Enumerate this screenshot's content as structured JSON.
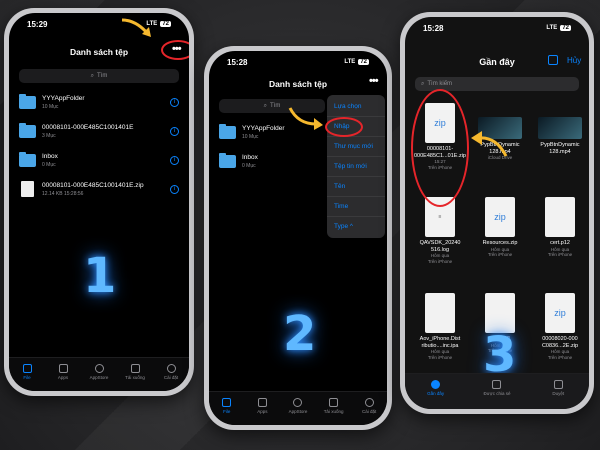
{
  "phone1": {
    "time": "15:29",
    "network": "LTE",
    "battery": "72",
    "title": "Danh sách tệp",
    "more": "•••",
    "search_placeholder": "Tìm",
    "rows": [
      {
        "name": "YYYAppFolder",
        "sub": "10 Mục",
        "type": "folder"
      },
      {
        "name": "00008101-000E485C1001401E",
        "sub": "3 Mục",
        "type": "folder"
      },
      {
        "name": "Inbox",
        "sub": "0 Mục",
        "type": "folder"
      },
      {
        "name": "00008101-000E485C1001401E.zip",
        "sub": "12.14 KB   15:28:56",
        "type": "file"
      }
    ],
    "tabs": [
      "File",
      "Apps",
      "AppStore",
      "Tải xuống",
      "Cài đặt"
    ],
    "step": "1"
  },
  "phone2": {
    "time": "15:28",
    "network": "LTE",
    "battery": "72",
    "title": "Danh sách tệp",
    "more": "•••",
    "search_placeholder": "Tìm",
    "rows": [
      {
        "name": "YYYAppFolder",
        "sub": "10 Mục",
        "type": "folder"
      },
      {
        "name": "Inbox",
        "sub": "0 Mục",
        "type": "folder"
      }
    ],
    "menu": [
      "Lựa chọn",
      "Nhập",
      "Thư mục mới",
      "Tệp tin mới",
      "Tên",
      "Time",
      "Type ^"
    ],
    "tabs": [
      "File",
      "Apps",
      "AppStore",
      "Tải xuống",
      "Cài đặt"
    ],
    "step": "2"
  },
  "phone3": {
    "time": "15:28",
    "network": "LTE",
    "battery": "72",
    "title": "Gần đây",
    "select": "Hủy",
    "search_placeholder": "Tìm kiếm",
    "items": [
      {
        "thumb": "zip",
        "name": "00008101-000E485C1...01E.zip",
        "sub1": "15:27",
        "sub2": "Trên iPhone"
      },
      {
        "thumb": "",
        "name": "PypBtnDynamic 128.mp4",
        "sub1": "",
        "sub2": "iCloud Drive"
      },
      {
        "thumb": "",
        "name": "PypBtnDynamic 128.mp4",
        "sub1": "",
        "sub2": ""
      },
      {
        "thumb": "doc",
        "name": "QAVSDK_20240 516.log",
        "sub1": "Hôm qua",
        "sub2": "Trên iPhone"
      },
      {
        "thumb": "zip",
        "name": "Resources.zip",
        "sub1": "Hôm qua",
        "sub2": "Trên iPhone"
      },
      {
        "thumb": "",
        "name": "cert.p12",
        "sub1": "Hôm qua",
        "sub2": "Trên iPhone"
      },
      {
        "thumb": "",
        "name": "Aov_iPhone.Dist ributio....inc.ipa",
        "sub1": "Hôm qua",
        "sub2": "Trên iPhone"
      },
      {
        "thumb": "",
        "name": "cert.p12",
        "sub1": "Hôm qua",
        "sub2": "Trên iPhone"
      },
      {
        "thumb": "zip",
        "name": "00008020-000 C0836...2E.zip",
        "sub1": "Hôm qua",
        "sub2": "Trên iPhone"
      }
    ],
    "tabs": [
      "Gần đây",
      "Được chia sẻ",
      "Duyệt"
    ],
    "step": "3"
  },
  "colors": {
    "accent": "#0a84ff",
    "folder": "#4aa6e8",
    "highlight": "#e5252a",
    "arrow": "#f5b82e"
  }
}
